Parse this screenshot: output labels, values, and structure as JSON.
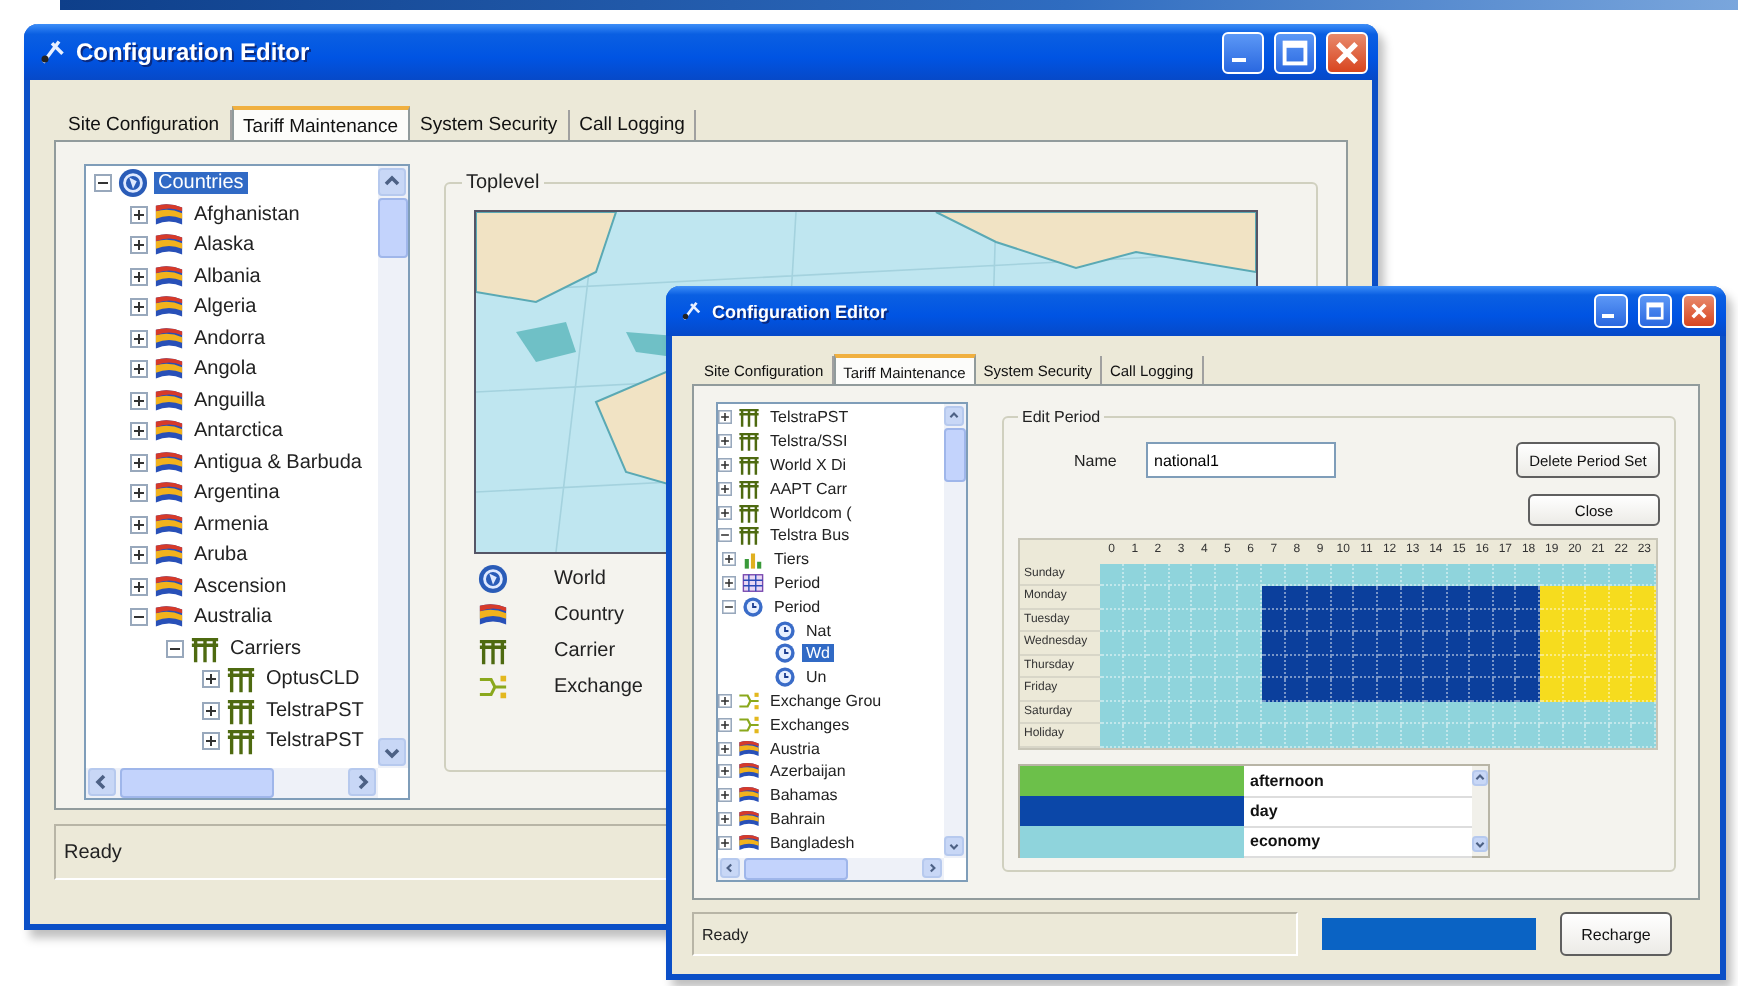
{
  "main_window": {
    "title": "Configuration Editor",
    "tabs": [
      {
        "label": "Site Configuration",
        "selected": false
      },
      {
        "label": "Tariff Maintenance",
        "selected": true
      },
      {
        "label": "System Security",
        "selected": false
      },
      {
        "label": "Call Logging",
        "selected": false
      }
    ],
    "tree": [
      {
        "label": "Countries",
        "kind": "world",
        "expanded": true,
        "selected": true,
        "children": [
          {
            "label": "Afghanistan",
            "kind": "country",
            "expanded": false,
            "selected": false
          },
          {
            "label": "Alaska",
            "kind": "country",
            "expanded": false,
            "selected": false
          },
          {
            "label": "Albania",
            "kind": "country",
            "expanded": false,
            "selected": false
          },
          {
            "label": "Algeria",
            "kind": "country",
            "expanded": false,
            "selected": false
          },
          {
            "label": "Andorra",
            "kind": "country",
            "expanded": false,
            "selected": false
          },
          {
            "label": "Angola",
            "kind": "country",
            "expanded": false,
            "selected": false
          },
          {
            "label": "Anguilla",
            "kind": "country",
            "expanded": false,
            "selected": false
          },
          {
            "label": "Antarctica",
            "kind": "country",
            "expanded": false,
            "selected": false
          },
          {
            "label": "Antigua & Barbuda",
            "kind": "country",
            "expanded": false,
            "selected": false
          },
          {
            "label": "Argentina",
            "kind": "country",
            "expanded": false,
            "selected": false
          },
          {
            "label": "Armenia",
            "kind": "country",
            "expanded": false,
            "selected": false
          },
          {
            "label": "Aruba",
            "kind": "country",
            "expanded": false,
            "selected": false
          },
          {
            "label": "Ascension",
            "kind": "country",
            "expanded": false,
            "selected": false
          },
          {
            "label": "Australia",
            "kind": "country",
            "expanded": true,
            "selected": false,
            "children": [
              {
                "label": "Carriers",
                "kind": "carrier",
                "expanded": true,
                "selected": false,
                "children": [
                  {
                    "label": "OptusCLD",
                    "kind": "carrier",
                    "expanded": false,
                    "selected": false
                  },
                  {
                    "label": "TelstraPST",
                    "kind": "carrier",
                    "expanded": false,
                    "selected": false
                  },
                  {
                    "label": "TelstraPST",
                    "kind": "carrier",
                    "expanded": false,
                    "selected": false
                  }
                ]
              }
            ]
          }
        ]
      }
    ],
    "toplevel": {
      "title": "Toplevel",
      "legend": [
        {
          "kind": "world",
          "label": "World"
        },
        {
          "kind": "country",
          "label": "Country"
        },
        {
          "kind": "carrier",
          "label": "Carrier"
        },
        {
          "kind": "exchange",
          "label": "Exchange"
        }
      ]
    },
    "status": "Ready"
  },
  "front_window": {
    "title": "Configuration Editor",
    "tabs": [
      {
        "label": "Site Configuration",
        "selected": false
      },
      {
        "label": "Tariff Maintenance",
        "selected": true
      },
      {
        "label": "System Security",
        "selected": false
      },
      {
        "label": "Call Logging",
        "selected": false
      }
    ],
    "tree": [
      {
        "children": [
          {
            "children": [
              {
                "children": [
                  {
                    "label": "TelstraPST",
                    "kind": "carrier",
                    "expanded": false,
                    "selected": false
                  },
                  {
                    "label": "Telstra/SSI",
                    "kind": "carrier",
                    "expanded": false,
                    "selected": false
                  },
                  {
                    "label": "World X Di",
                    "kind": "carrier",
                    "expanded": false,
                    "selected": false
                  },
                  {
                    "label": "AAPT Carr",
                    "kind": "carrier",
                    "expanded": false,
                    "selected": false
                  },
                  {
                    "label": "Worldcom (",
                    "kind": "carrier",
                    "expanded": false,
                    "selected": false
                  },
                  {
                    "label": "Telstra Bus",
                    "kind": "carrier",
                    "expanded": true,
                    "selected": false,
                    "children": [
                      {
                        "label": "Tiers",
                        "kind": "tiers",
                        "expanded": false,
                        "selected": false
                      },
                      {
                        "label": "Period",
                        "kind": "period",
                        "expanded": false,
                        "selected": false
                      },
                      {
                        "label": "Period",
                        "kind": "clock",
                        "expanded": true,
                        "selected": false,
                        "children": [
                          {
                            "label": "Nat",
                            "kind": "clock",
                            "selected": false
                          },
                          {
                            "label": "Wd",
                            "kind": "clock",
                            "selected": true
                          },
                          {
                            "label": "Un",
                            "kind": "clock",
                            "selected": false
                          }
                        ]
                      }
                    ]
                  }
                ]
              },
              {
                "label": "Exchange Grou",
                "kind": "exchange",
                "expanded": false,
                "selected": false
              },
              {
                "label": "Exchanges",
                "kind": "exchange",
                "expanded": false,
                "selected": false
              }
            ]
          },
          {
            "label": "Austria",
            "kind": "country",
            "expanded": false,
            "selected": false
          },
          {
            "label": "Azerbaijan",
            "kind": "country",
            "expanded": false,
            "selected": false
          },
          {
            "label": "Bahamas",
            "kind": "country",
            "expanded": false,
            "selected": false
          },
          {
            "label": "Bahrain",
            "kind": "country",
            "expanded": false,
            "selected": false
          },
          {
            "label": "Bangladesh",
            "kind": "country",
            "expanded": false,
            "selected": false
          }
        ]
      }
    ],
    "edit_period": {
      "title": "Edit Period",
      "name_label": "Name",
      "name_value": "national1",
      "buttons": [
        "Delete Period Set",
        "Close"
      ],
      "grid": {
        "hours": [
          "0",
          "1",
          "2",
          "3",
          "4",
          "5",
          "6",
          "7",
          "8",
          "9",
          "10",
          "11",
          "12",
          "13",
          "14",
          "15",
          "16",
          "17",
          "18",
          "19",
          "20",
          "21",
          "22",
          "23"
        ],
        "rows": [
          {
            "label": "Sunday",
            "cells": [
              {
                "color": "#8fd4dc"
              },
              {
                "color": "#8fd4dc"
              },
              {
                "color": "#8fd4dc"
              },
              {
                "color": "#8fd4dc"
              },
              {
                "color": "#8fd4dc"
              },
              {
                "color": "#8fd4dc"
              },
              {
                "color": "#8fd4dc"
              },
              {
                "color": "#8fd4dc"
              },
              {
                "color": "#8fd4dc"
              },
              {
                "color": "#8fd4dc"
              },
              {
                "color": "#8fd4dc"
              },
              {
                "color": "#8fd4dc"
              },
              {
                "color": "#8fd4dc"
              },
              {
                "color": "#8fd4dc"
              },
              {
                "color": "#8fd4dc"
              },
              {
                "color": "#8fd4dc"
              },
              {
                "color": "#8fd4dc"
              },
              {
                "color": "#8fd4dc"
              },
              {
                "color": "#8fd4dc"
              },
              {
                "color": "#8fd4dc"
              },
              {
                "color": "#8fd4dc"
              },
              {
                "color": "#8fd4dc"
              },
              {
                "color": "#8fd4dc"
              },
              {
                "color": "#8fd4dc"
              }
            ]
          },
          {
            "label": "Monday",
            "cells": [
              {
                "color": "#8fd4dc"
              },
              {
                "color": "#8fd4dc"
              },
              {
                "color": "#8fd4dc"
              },
              {
                "color": "#8fd4dc"
              },
              {
                "color": "#8fd4dc"
              },
              {
                "color": "#8fd4dc"
              },
              {
                "color": "#8fd4dc"
              },
              {
                "color": "#0b3f9c"
              },
              {
                "color": "#0b3f9c"
              },
              {
                "color": "#0b3f9c"
              },
              {
                "color": "#0b3f9c"
              },
              {
                "color": "#0b3f9c"
              },
              {
                "color": "#0b3f9c"
              },
              {
                "color": "#0b3f9c"
              },
              {
                "color": "#0b3f9c"
              },
              {
                "color": "#0b3f9c"
              },
              {
                "color": "#0b3f9c"
              },
              {
                "color": "#0b3f9c"
              },
              {
                "color": "#0b3f9c"
              },
              {
                "color": "#f6dc1e"
              },
              {
                "color": "#f6dc1e"
              },
              {
                "color": "#f6dc1e"
              },
              {
                "color": "#f6dc1e"
              },
              {
                "color": "#f6dc1e"
              }
            ]
          },
          {
            "label": "Tuesday",
            "cells": [
              {
                "color": "#8fd4dc"
              },
              {
                "color": "#8fd4dc"
              },
              {
                "color": "#8fd4dc"
              },
              {
                "color": "#8fd4dc"
              },
              {
                "color": "#8fd4dc"
              },
              {
                "color": "#8fd4dc"
              },
              {
                "color": "#8fd4dc"
              },
              {
                "color": "#0b3f9c"
              },
              {
                "color": "#0b3f9c"
              },
              {
                "color": "#0b3f9c"
              },
              {
                "color": "#0b3f9c"
              },
              {
                "color": "#0b3f9c"
              },
              {
                "color": "#0b3f9c"
              },
              {
                "color": "#0b3f9c"
              },
              {
                "color": "#0b3f9c"
              },
              {
                "color": "#0b3f9c"
              },
              {
                "color": "#0b3f9c"
              },
              {
                "color": "#0b3f9c"
              },
              {
                "color": "#0b3f9c"
              },
              {
                "color": "#f6dc1e"
              },
              {
                "color": "#f6dc1e"
              },
              {
                "color": "#f6dc1e"
              },
              {
                "color": "#f6dc1e"
              },
              {
                "color": "#f6dc1e"
              }
            ]
          },
          {
            "label": "Wednesday",
            "cells": [
              {
                "color": "#8fd4dc"
              },
              {
                "color": "#8fd4dc"
              },
              {
                "color": "#8fd4dc"
              },
              {
                "color": "#8fd4dc"
              },
              {
                "color": "#8fd4dc"
              },
              {
                "color": "#8fd4dc"
              },
              {
                "color": "#8fd4dc"
              },
              {
                "color": "#0b3f9c"
              },
              {
                "color": "#0b3f9c"
              },
              {
                "color": "#0b3f9c"
              },
              {
                "color": "#0b3f9c"
              },
              {
                "color": "#0b3f9c"
              },
              {
                "color": "#0b3f9c"
              },
              {
                "color": "#0b3f9c"
              },
              {
                "color": "#0b3f9c"
              },
              {
                "color": "#0b3f9c"
              },
              {
                "color": "#0b3f9c"
              },
              {
                "color": "#0b3f9c"
              },
              {
                "color": "#0b3f9c"
              },
              {
                "color": "#f6dc1e"
              },
              {
                "color": "#f6dc1e"
              },
              {
                "color": "#f6dc1e"
              },
              {
                "color": "#f6dc1e"
              },
              {
                "color": "#f6dc1e"
              }
            ]
          },
          {
            "label": "Thursday",
            "cells": [
              {
                "color": "#8fd4dc"
              },
              {
                "color": "#8fd4dc"
              },
              {
                "color": "#8fd4dc"
              },
              {
                "color": "#8fd4dc"
              },
              {
                "color": "#8fd4dc"
              },
              {
                "color": "#8fd4dc"
              },
              {
                "color": "#8fd4dc"
              },
              {
                "color": "#0b3f9c"
              },
              {
                "color": "#0b3f9c"
              },
              {
                "color": "#0b3f9c"
              },
              {
                "color": "#0b3f9c"
              },
              {
                "color": "#0b3f9c"
              },
              {
                "color": "#0b3f9c"
              },
              {
                "color": "#0b3f9c"
              },
              {
                "color": "#0b3f9c"
              },
              {
                "color": "#0b3f9c"
              },
              {
                "color": "#0b3f9c"
              },
              {
                "color": "#0b3f9c"
              },
              {
                "color": "#0b3f9c"
              },
              {
                "color": "#f6dc1e"
              },
              {
                "color": "#f6dc1e"
              },
              {
                "color": "#f6dc1e"
              },
              {
                "color": "#f6dc1e"
              },
              {
                "color": "#f6dc1e"
              }
            ]
          },
          {
            "label": "Friday",
            "cells": [
              {
                "color": "#8fd4dc"
              },
              {
                "color": "#8fd4dc"
              },
              {
                "color": "#8fd4dc"
              },
              {
                "color": "#8fd4dc"
              },
              {
                "color": "#8fd4dc"
              },
              {
                "color": "#8fd4dc"
              },
              {
                "color": "#8fd4dc"
              },
              {
                "color": "#0b3f9c"
              },
              {
                "color": "#0b3f9c"
              },
              {
                "color": "#0b3f9c"
              },
              {
                "color": "#0b3f9c"
              },
              {
                "color": "#0b3f9c"
              },
              {
                "color": "#0b3f9c"
              },
              {
                "color": "#0b3f9c"
              },
              {
                "color": "#0b3f9c"
              },
              {
                "color": "#0b3f9c"
              },
              {
                "color": "#0b3f9c"
              },
              {
                "color": "#0b3f9c"
              },
              {
                "color": "#0b3f9c"
              },
              {
                "color": "#f6dc1e"
              },
              {
                "color": "#f6dc1e"
              },
              {
                "color": "#f6dc1e"
              },
              {
                "color": "#f6dc1e"
              },
              {
                "color": "#f6dc1e"
              }
            ]
          },
          {
            "label": "Saturday",
            "cells": [
              {
                "color": "#8fd4dc"
              },
              {
                "color": "#8fd4dc"
              },
              {
                "color": "#8fd4dc"
              },
              {
                "color": "#8fd4dc"
              },
              {
                "color": "#8fd4dc"
              },
              {
                "color": "#8fd4dc"
              },
              {
                "color": "#8fd4dc"
              },
              {
                "color": "#8fd4dc"
              },
              {
                "color": "#8fd4dc"
              },
              {
                "color": "#8fd4dc"
              },
              {
                "color": "#8fd4dc"
              },
              {
                "color": "#8fd4dc"
              },
              {
                "color": "#8fd4dc"
              },
              {
                "color": "#8fd4dc"
              },
              {
                "color": "#8fd4dc"
              },
              {
                "color": "#8fd4dc"
              },
              {
                "color": "#8fd4dc"
              },
              {
                "color": "#8fd4dc"
              },
              {
                "color": "#8fd4dc"
              },
              {
                "color": "#8fd4dc"
              },
              {
                "color": "#8fd4dc"
              },
              {
                "color": "#8fd4dc"
              },
              {
                "color": "#8fd4dc"
              },
              {
                "color": "#8fd4dc"
              }
            ]
          },
          {
            "label": "Holiday",
            "cells": [
              {
                "color": "#8fd4dc"
              },
              {
                "color": "#8fd4dc"
              },
              {
                "color": "#8fd4dc"
              },
              {
                "color": "#8fd4dc"
              },
              {
                "color": "#8fd4dc"
              },
              {
                "color": "#8fd4dc"
              },
              {
                "color": "#8fd4dc"
              },
              {
                "color": "#8fd4dc"
              },
              {
                "color": "#8fd4dc"
              },
              {
                "color": "#8fd4dc"
              },
              {
                "color": "#8fd4dc"
              },
              {
                "color": "#8fd4dc"
              },
              {
                "color": "#8fd4dc"
              },
              {
                "color": "#8fd4dc"
              },
              {
                "color": "#8fd4dc"
              },
              {
                "color": "#8fd4dc"
              },
              {
                "color": "#8fd4dc"
              },
              {
                "color": "#8fd4dc"
              },
              {
                "color": "#8fd4dc"
              },
              {
                "color": "#8fd4dc"
              },
              {
                "color": "#8fd4dc"
              },
              {
                "color": "#8fd4dc"
              },
              {
                "color": "#8fd4dc"
              },
              {
                "color": "#8fd4dc"
              }
            ]
          }
        ]
      },
      "periods": [
        {
          "name": "afternoon",
          "color": "#6cc04a"
        },
        {
          "name": "day",
          "color": "#0b47a8"
        },
        {
          "name": "economy",
          "color": "#8fd4dc"
        }
      ]
    },
    "status": {
      "text": "Ready",
      "progress": {
        "level": 1
      },
      "button": "Recharge"
    }
  }
}
